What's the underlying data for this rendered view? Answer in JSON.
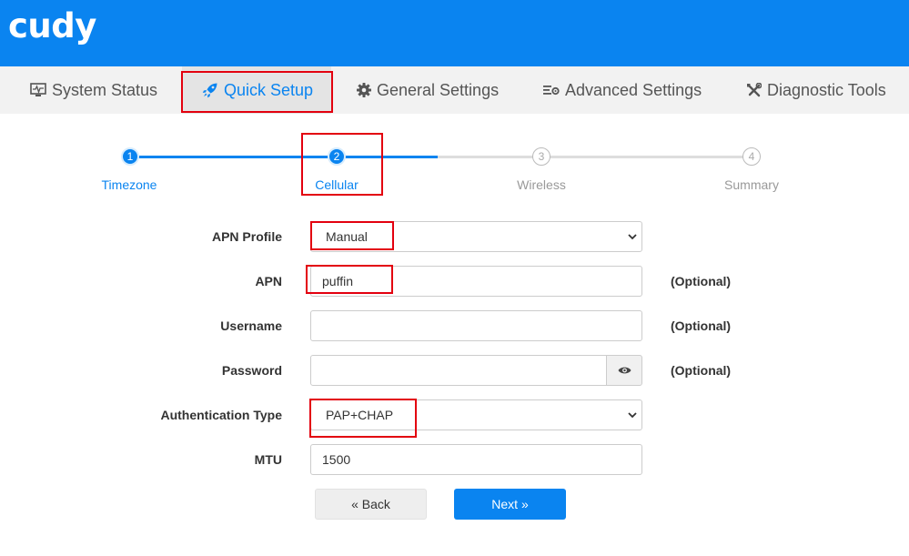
{
  "brand": {
    "logo_text": "cudy",
    "primary_color": "#0a84f0",
    "highlight_color": "#e3000f"
  },
  "nav": {
    "items": [
      {
        "label": "System Status",
        "icon": "monitor-icon"
      },
      {
        "label": "Quick Setup",
        "icon": "rocket-icon",
        "active": true
      },
      {
        "label": "General Settings",
        "icon": "gear-icon"
      },
      {
        "label": "Advanced Settings",
        "icon": "sliders-icon"
      },
      {
        "label": "Diagnostic Tools",
        "icon": "tools-icon"
      }
    ]
  },
  "stepper": {
    "steps": [
      {
        "number": "1",
        "label": "Timezone",
        "state": "done"
      },
      {
        "number": "2",
        "label": "Cellular",
        "state": "current"
      },
      {
        "number": "3",
        "label": "Wireless",
        "state": "todo"
      },
      {
        "number": "4",
        "label": "Summary",
        "state": "todo"
      }
    ]
  },
  "form": {
    "apn_profile": {
      "label": "APN Profile",
      "value": "Manual"
    },
    "apn": {
      "label": "APN",
      "value": "puffin",
      "note": "(Optional)"
    },
    "username": {
      "label": "Username",
      "value": "",
      "note": "(Optional)"
    },
    "password": {
      "label": "Password",
      "value": "",
      "note": "(Optional)"
    },
    "auth_type": {
      "label": "Authentication Type",
      "value": "PAP+CHAP"
    },
    "mtu": {
      "label": "MTU",
      "value": "1500"
    }
  },
  "buttons": {
    "back_label": "« Back",
    "next_label": "Next »"
  }
}
